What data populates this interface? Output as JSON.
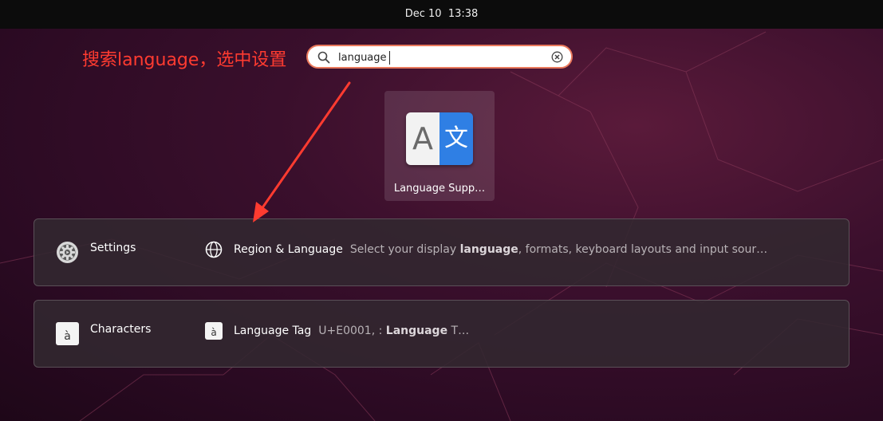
{
  "topbar": {
    "clock": "Dec 10  13:38"
  },
  "annotation": {
    "text": "搜索language，选中设置",
    "color": "#ff3b30"
  },
  "search": {
    "value": "language",
    "icon": "search-icon",
    "clear_icon": "clear-icon"
  },
  "apps": [
    {
      "label": "Language Supp…",
      "icon": "language-support-icon",
      "icon_left_glyph": "A",
      "icon_right_glyph": "文"
    }
  ],
  "results": [
    {
      "provider": "Settings",
      "provider_icon": "settings-gear-icon",
      "item_icon": "globe-icon",
      "title": "Region & Language",
      "desc_before": "Select your display ",
      "desc_bold": "language",
      "desc_after": ", formats, keyboard layouts and input sour…"
    },
    {
      "provider": "Characters",
      "provider_icon": "characters-app-icon",
      "provider_glyph": "à",
      "item_icon": "character-glyph-icon",
      "item_glyph": "à",
      "title": "Language Tag",
      "desc_before": "U+E0001, : ",
      "desc_bold": "Language",
      "desc_after": " T…"
    }
  ],
  "colors": {
    "accent_border": "#e9785b",
    "app_icon_blue": "#2f7fe4"
  }
}
